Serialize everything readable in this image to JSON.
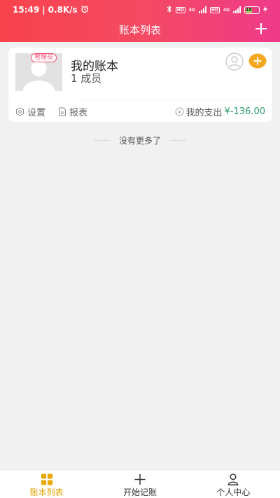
{
  "status_bar": {
    "time": "15:49",
    "network_speed": "0.8K/s",
    "hd1": "HD",
    "hd2": "HD",
    "net1": "4G",
    "net2": "4G",
    "battery_level": "48"
  },
  "header": {
    "title": "账本列表"
  },
  "ledger": {
    "role_badge": "管理员",
    "name": "我的账本",
    "member_count": "1 成员",
    "settings_label": "设置",
    "report_label": "报表",
    "spend_label": "我的支出",
    "spend_amount": "¥-136.00"
  },
  "list_end_text": "没有更多了",
  "bottom_nav": {
    "items": [
      {
        "label": "账本列表",
        "icon": "grid-icon",
        "active": true
      },
      {
        "label": "开始记账",
        "icon": "plus-icon",
        "active": false
      },
      {
        "label": "个人中心",
        "icon": "user-icon",
        "active": false
      }
    ]
  },
  "colors": {
    "header_gradient_start": "#f8434d",
    "header_gradient_end": "#ee3a8a",
    "active_nav": "#e2a300",
    "accent_orange": "#f4a720",
    "spend_green": "#2a9d6a"
  }
}
